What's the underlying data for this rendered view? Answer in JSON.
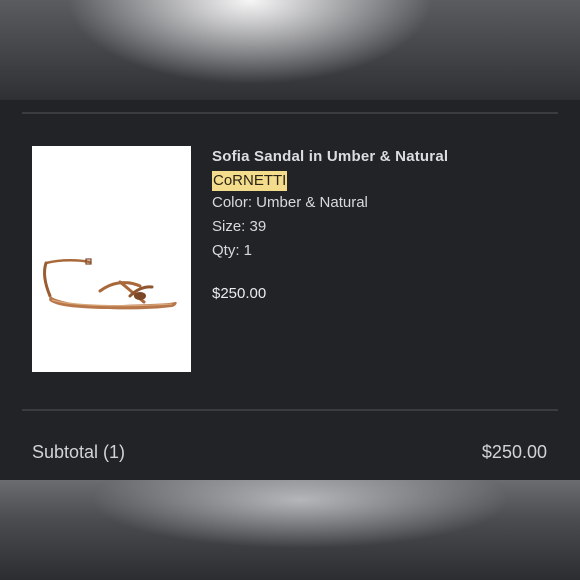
{
  "product": {
    "name": "Sofia Sandal in Umber & Natural",
    "brand": "CoRNETTI",
    "color_line": "Color: Umber & Natural",
    "size_line": "Size: 39",
    "qty_line": "Qty: 1",
    "price": "$250.00",
    "image_icon": "sandal-image"
  },
  "summary": {
    "subtotal_label": "Subtotal (1)",
    "subtotal_value": "$250.00"
  },
  "colors": {
    "panel_bg": "#222326",
    "brand_highlight": "#f3dc8c",
    "sandal_leather": "#a8683a"
  }
}
